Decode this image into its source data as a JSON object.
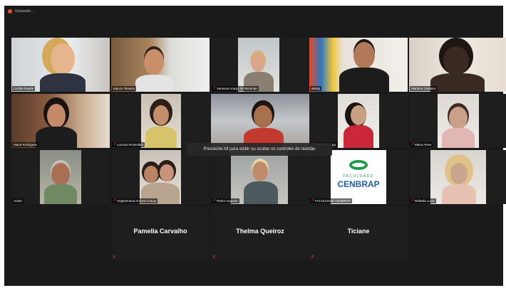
{
  "window": {
    "title": "Gravando..."
  },
  "participants": [
    {
      "name": "Cecilia Duarte",
      "muted": false
    },
    {
      "name": "Marcio Teixeira",
      "muted": false
    },
    {
      "name": "Vanessa Araujo de Rezende",
      "muted": true
    },
    {
      "name": "Wesly",
      "muted": false
    },
    {
      "name": "Marlene Caetano",
      "muted": false
    },
    {
      "name": "Maria Rodrigues",
      "muted": false
    },
    {
      "name": "Luciana Rosenildo",
      "muted": true
    },
    {
      "name": "",
      "muted": false
    },
    {
      "name": "Daniela Tunga",
      "muted": true
    },
    {
      "name": "Maria Alves",
      "muted": true
    },
    {
      "name": "Andre",
      "muted": false
    },
    {
      "name": "Angelomaria Aniceto Araujo",
      "muted": true
    },
    {
      "name": "Pedro Augusto",
      "muted": true
    },
    {
      "name": "FACULDADE CENBRAP",
      "muted": true
    },
    {
      "name": "Rafaela Lucia",
      "muted": true
    }
  ],
  "no_video": [
    {
      "name": "Pamella Carvalho"
    },
    {
      "name": "Thelma Queiroz"
    },
    {
      "name": "Ticiane"
    }
  ],
  "logo": {
    "line1": "FACULDADE",
    "line2": "CENBRAP"
  },
  "tooltip": {
    "text": "Pressione Alt para exibir ou ocultar os controles de reunião"
  },
  "colors": {
    "active_speaker": "#b7e34c",
    "muted": "#e33333",
    "logo_green": "#1f9a4a",
    "logo_blue": "#1f5ea8"
  }
}
